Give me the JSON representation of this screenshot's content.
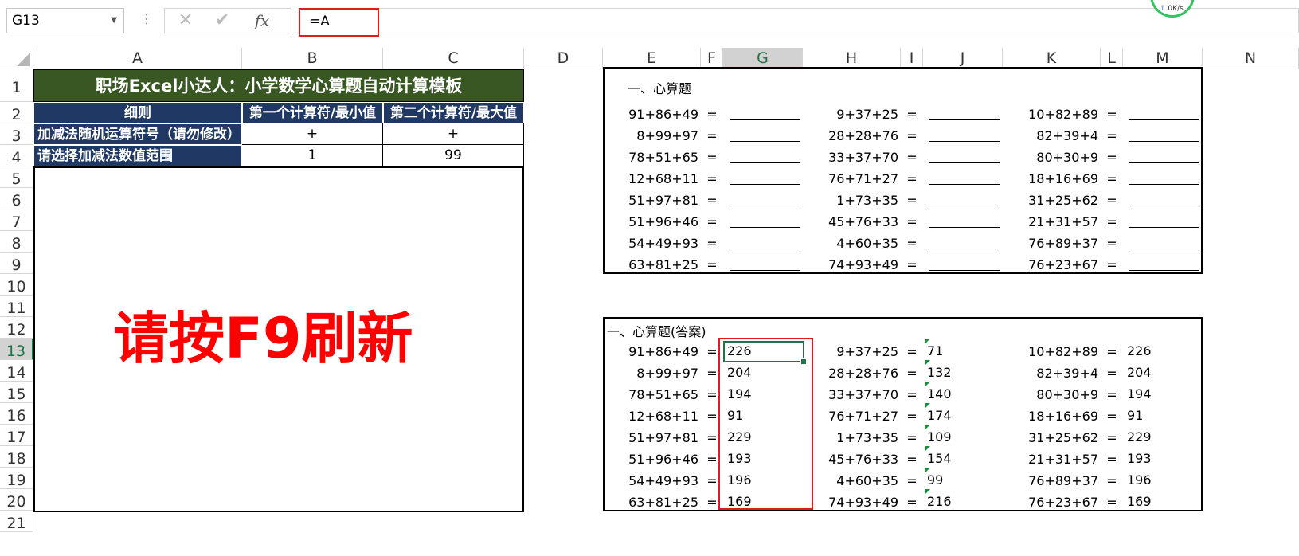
{
  "formula_bar": {
    "name_box": "G13",
    "cancel_icon": "✕",
    "enter_icon": "✔",
    "fx_label": "fx",
    "formula": "=A"
  },
  "net_widget": {
    "speed": "0K/s"
  },
  "columns": [
    "A",
    "B",
    "C",
    "D",
    "E",
    "F",
    "G",
    "H",
    "I",
    "J",
    "K",
    "L",
    "M",
    "N"
  ],
  "rows": [
    "1",
    "2",
    "3",
    "4",
    "5",
    "6",
    "7",
    "8",
    "9",
    "10",
    "11",
    "12",
    "13",
    "14",
    "15",
    "16",
    "17",
    "18",
    "19",
    "20",
    "21"
  ],
  "selected_cell": "G13",
  "left_table": {
    "title": "职场Excel小达人：小学数学心算题自动计算模板",
    "headers": [
      "细则",
      "第一个计算符/最小值",
      "第二个计算符/最大值"
    ],
    "row3": {
      "label": "加减法随机运算符号（请勿修改）",
      "b": "+",
      "c": "+"
    },
    "row4": {
      "label": "请选择加减法数值范围",
      "b": "1",
      "c": "99"
    },
    "refresh_hint": "请按F9刷新"
  },
  "questions": {
    "section_title": "一、心算题",
    "eq": "=",
    "col1": [
      "91+86+49",
      "8+99+97",
      "78+51+65",
      "12+68+11",
      "51+97+81",
      "51+96+46",
      "54+49+93",
      "63+81+25"
    ],
    "col2": [
      "9+37+25",
      "28+28+76",
      "33+37+70",
      "76+71+27",
      "1+73+35",
      "45+76+33",
      "4+60+35",
      "74+93+49"
    ],
    "col3": [
      "10+82+89",
      "82+39+4",
      "80+30+9",
      "18+16+69",
      "31+25+62",
      "21+31+57",
      "76+89+37",
      "76+23+67"
    ]
  },
  "answers": {
    "section_title": "一、心算题(答案)",
    "col1": [
      "226",
      "204",
      "194",
      "91",
      "229",
      "193",
      "196",
      "169"
    ],
    "col2": [
      "71",
      "132",
      "140",
      "174",
      "109",
      "154",
      "99",
      "216"
    ],
    "col3": [
      "226",
      "204",
      "194",
      "91",
      "229",
      "193",
      "196",
      "169"
    ]
  },
  "colors": {
    "title_bg": "#385723",
    "header_bg": "#1f3864",
    "highlight": "#e31a1c",
    "excel_green": "#217346"
  }
}
